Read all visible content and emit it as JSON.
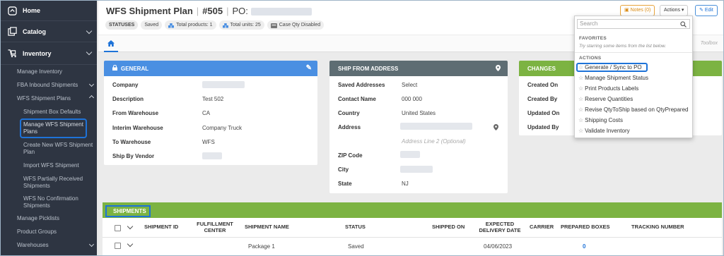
{
  "sidebar": {
    "home": "Home",
    "catalog": "Catalog",
    "inventory": "Inventory",
    "items": [
      {
        "label": "Manage Inventory"
      },
      {
        "label": "FBA Inbound Shipments"
      },
      {
        "label": "WFS Shipment Plans"
      },
      {
        "label": "Shipment Box Defaults"
      },
      {
        "label": "Manage WFS Shipment Plans"
      },
      {
        "label": "Create New WFS Shipment Plan"
      },
      {
        "label": "Import WFS Shipment"
      },
      {
        "label": "WFS Partially Received Shipments"
      },
      {
        "label": "WFS No Confirmation Shipments"
      },
      {
        "label": "Manage Picklists"
      },
      {
        "label": "Product Groups"
      },
      {
        "label": "Warehouses"
      }
    ]
  },
  "header": {
    "title": "WFS Shipment Plan",
    "plan_number": "#505",
    "po_label": "PO:",
    "statuses_label": "STATUSES",
    "saved_label": "Saved",
    "total_products": "Total products: 1",
    "total_units": "Total units: 25",
    "case_qty": "Case Qty Disabled",
    "notes_label": "Notes (0)",
    "actions_label": "Actions",
    "edit_label": "Edit",
    "toolbox_label": "Toolbox"
  },
  "general": {
    "title": "GENERAL",
    "rows": [
      {
        "label": "Company",
        "value": ""
      },
      {
        "label": "Description",
        "value": "Test 502"
      },
      {
        "label": "From Warehouse",
        "value": "CA"
      },
      {
        "label": "Interim Warehouse",
        "value": "Company Truck"
      },
      {
        "label": "To Warehouse",
        "value": "WFS"
      },
      {
        "label": "Ship By Vendor",
        "value": ""
      }
    ]
  },
  "ship_from": {
    "title": "SHIP FROM ADDRESS",
    "rows": [
      {
        "label": "Saved Addresses",
        "value": "Select"
      },
      {
        "label": "Contact Name",
        "value": "000 000"
      },
      {
        "label": "Country",
        "value": "United States"
      },
      {
        "label": "Address",
        "value": ""
      },
      {
        "label": "",
        "value": "Address Line 2 (Optional)"
      },
      {
        "label": "ZIP Code",
        "value": ""
      },
      {
        "label": "City",
        "value": ""
      },
      {
        "label": "State",
        "value": "NJ"
      }
    ]
  },
  "changes": {
    "title": "CHANGES",
    "rows": [
      {
        "label": "Created On"
      },
      {
        "label": "Created By"
      },
      {
        "label": "Updated On"
      },
      {
        "label": "Updated By"
      }
    ]
  },
  "dropdown": {
    "search_placeholder": "Search",
    "favorites_label": "FAVORITES",
    "favorites_note": "Try starring some items from the list below.",
    "actions_label": "ACTIONS",
    "items": [
      "Generate / Sync to PO",
      "Manage Shipment Status",
      "Print Products Labels",
      "Reserve Quantities",
      "Revise QtyToShip based on QtyPrepared",
      "Shipping Costs",
      "Validate Inventory"
    ]
  },
  "shipments": {
    "title": "SHIPMENTS",
    "columns": [
      "SHIPMENT ID",
      "FULFILLMENT CENTER",
      "SHIPMENT NAME",
      "STATUS",
      "SHIPPED ON",
      "EXPECTED DELIVERY DATE",
      "CARRIER",
      "PREPARED BOXES",
      "TRACKING NUMBER"
    ],
    "rows": [
      {
        "shipment_name": "Package 1",
        "status": "Saved",
        "expected": "04/06/2023",
        "prepared_boxes": "0"
      }
    ]
  },
  "colors": {
    "sidebar": "#2e3542",
    "general_header": "#4a8fe2",
    "ship_from_header": "#5e6d73",
    "changes_header": "#7cb342",
    "accent": "#1e73d8"
  }
}
